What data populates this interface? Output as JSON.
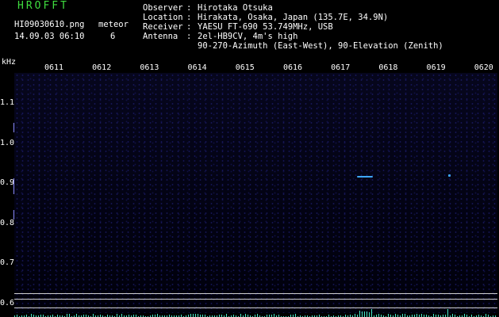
{
  "app_title": "HROFFT",
  "filename": "HI09030610.png",
  "datetime": "14.09.03 06:10",
  "meteor": {
    "label": "meteor",
    "count": "6"
  },
  "info": {
    "observer": {
      "key": "Observer",
      "value": "Hirotaka Otsuka"
    },
    "location": {
      "key": "Location",
      "value": "Hirakata, Osaka, Japan (135.7E, 34.9N)"
    },
    "receiver": {
      "key": "Receiver",
      "value": "YAESU FT-690 53.749MHz, USB"
    },
    "antenna": {
      "key": "Antenna",
      "value": "2el-HB9CV, 4m's high",
      "value2": "90-270-Azimuth (East-West), 90-Elevation (Zenith)"
    }
  },
  "colors": {
    "title": "#3fdc3f",
    "echo": "#3fa7ff",
    "spectrum": "#49e8c8"
  },
  "axis": {
    "unit": "kHz",
    "time_ticks": [
      "0611",
      "0612",
      "0613",
      "0614",
      "0615",
      "0616",
      "0617",
      "0618",
      "0619",
      "0620"
    ],
    "freq_ticks": [
      "1.1",
      "1.0",
      "0.9",
      "0.8",
      "0.7",
      "0.6"
    ]
  }
}
